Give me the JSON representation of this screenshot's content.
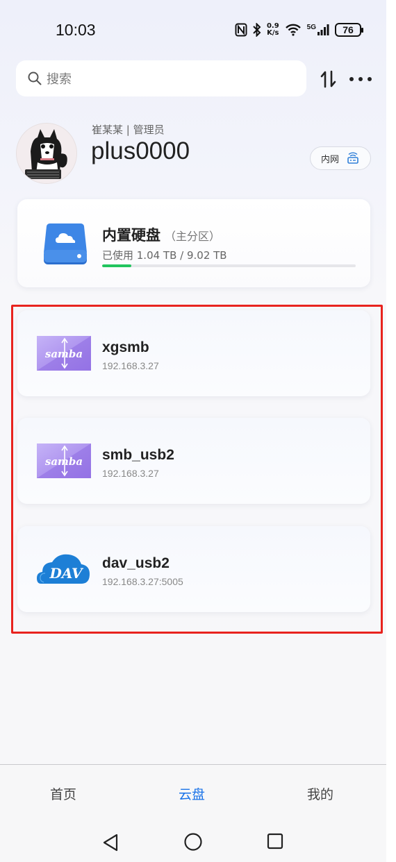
{
  "status_bar": {
    "time": "10:03",
    "speed_value": "0.9",
    "speed_unit": "K/s",
    "network": "5G",
    "battery": "76"
  },
  "search": {
    "placeholder": "搜索"
  },
  "profile": {
    "role": "崔某某 | 管理员",
    "username": "plus0000",
    "network_badge": "内网"
  },
  "storage": {
    "title": "内置硬盘",
    "subtitle": "（主分区）",
    "usage": "已使用 1.04 TB / 9.02 TB",
    "used_fraction": 0.115,
    "progress_color": "#22c55e"
  },
  "servers": [
    {
      "name": "xgsmb",
      "address": "192.168.3.27",
      "icon": "samba-logo"
    },
    {
      "name": "smb_usb2",
      "address": "192.168.3.27",
      "icon": "samba-logo"
    },
    {
      "name": "dav_usb2",
      "address": "192.168.3.27:5005",
      "icon": "webdav-logo"
    }
  ],
  "logos": {
    "samba": "samba",
    "webdav": "DAV"
  },
  "bottom_nav": {
    "items": [
      {
        "label": "首页"
      },
      {
        "label": "云盘",
        "active": true
      },
      {
        "label": "我的"
      }
    ]
  },
  "colors": {
    "accent": "#1a73e8",
    "highlight": "#e8231e",
    "samba_purple": "#a98bf0",
    "drive_blue": "#3d86e6"
  }
}
